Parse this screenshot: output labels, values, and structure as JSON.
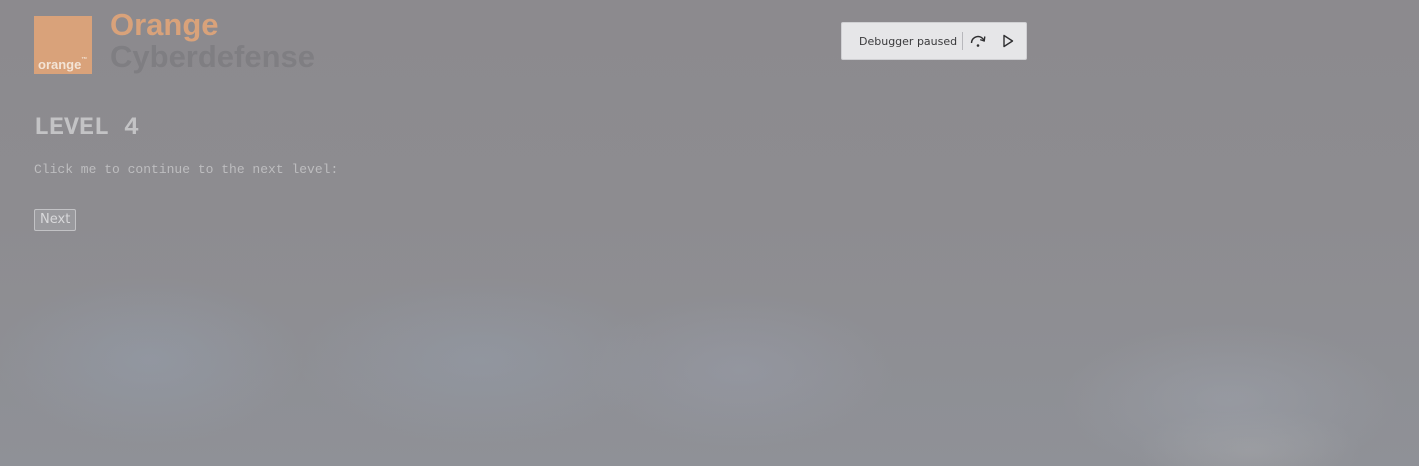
{
  "brand": {
    "logo_word": "orange",
    "logo_tm": "™",
    "line1": "Orange",
    "line2": "Cyberdefense",
    "colors": {
      "primary": "#d9a27a",
      "secondary": "#7f7e82"
    }
  },
  "debugger": {
    "status": "Debugger paused",
    "step_over_icon": "step-over-icon",
    "resume_icon": "resume-icon"
  },
  "level": {
    "title": "LEVEL 4",
    "description": "Click me to continue to the next level:",
    "next_label": "Next"
  },
  "overlay_color": "#8d8c90"
}
